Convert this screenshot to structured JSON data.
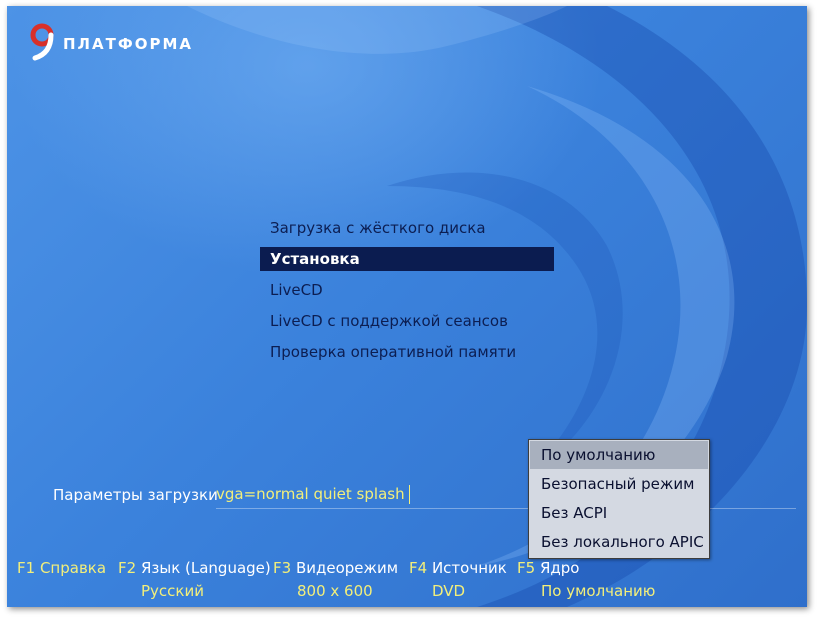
{
  "brand": {
    "logo_digit": "9",
    "logo_text": "ПЛАТФОРМА"
  },
  "boot_menu": {
    "items": [
      {
        "label": "Загрузка с жёсткого диска",
        "selected": false
      },
      {
        "label": "Установка",
        "selected": true
      },
      {
        "label": "LiveCD",
        "selected": false
      },
      {
        "label": "LiveCD с поддержкой сеансов",
        "selected": false
      },
      {
        "label": "Проверка оперативной памяти",
        "selected": false
      }
    ]
  },
  "boot_params": {
    "label": "Параметры загрузки",
    "value": "vga=normal quiet splash"
  },
  "kernel_popup": {
    "items": [
      {
        "label": "По умолчанию",
        "selected": true
      },
      {
        "label": "Безопасный режим",
        "selected": false
      },
      {
        "label": "Без ACPI",
        "selected": false
      },
      {
        "label": "Без локального APIC",
        "selected": false
      }
    ]
  },
  "function_keys": {
    "f1": {
      "key": "F1",
      "label": "Справка",
      "value": ""
    },
    "f2": {
      "key": "F2",
      "label": "Язык (Language)",
      "value": "Русский"
    },
    "f3": {
      "key": "F3",
      "label": "Видеорежим",
      "value": "800 x 600"
    },
    "f4": {
      "key": "F4",
      "label": "Источник",
      "value": "DVD"
    },
    "f5": {
      "key": "F5",
      "label": "Ядро",
      "value": "По умолчанию"
    }
  },
  "colors": {
    "background": "#3b82dc",
    "menu_text": "#0c1e52",
    "selection": "#0b1c50",
    "accent_text": "#f3ef7a",
    "popup_bg": "#d4d9e2",
    "popup_selection": "#a8b0be"
  }
}
